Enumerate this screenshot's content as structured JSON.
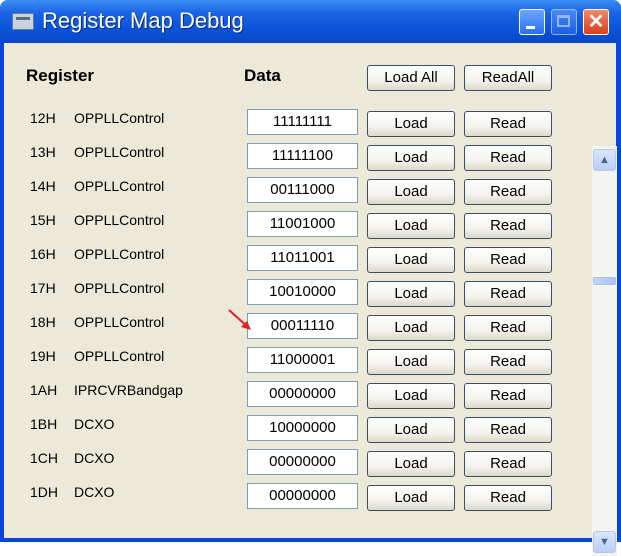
{
  "window": {
    "title": "Register Map Debug"
  },
  "header": {
    "register_label": "Register",
    "data_label": "Data",
    "load_all_label": "Load All",
    "read_all_label": "ReadAll"
  },
  "buttons": {
    "load": "Load",
    "read": "Read"
  },
  "rows": [
    {
      "addr": "12H",
      "name": "OPPLLControl",
      "value": "11111111"
    },
    {
      "addr": "13H",
      "name": "OPPLLControl",
      "value": "11111100"
    },
    {
      "addr": "14H",
      "name": "OPPLLControl",
      "value": "00111000"
    },
    {
      "addr": "15H",
      "name": "OPPLLControl",
      "value": "11001000"
    },
    {
      "addr": "16H",
      "name": "OPPLLControl",
      "value": "11011001"
    },
    {
      "addr": "17H",
      "name": "OPPLLControl",
      "value": "10010000"
    },
    {
      "addr": "18H",
      "name": "OPPLLControl",
      "value": "00011110"
    },
    {
      "addr": "19H",
      "name": "OPPLLControl",
      "value": "11000001"
    },
    {
      "addr": "1AH",
      "name": "IPRCVRBandgap",
      "value": "00000000"
    },
    {
      "addr": "1BH",
      "name": "DCXO",
      "value": "10000000"
    },
    {
      "addr": "1CH",
      "name": "DCXO",
      "value": "00000000"
    },
    {
      "addr": "1DH",
      "name": "DCXO",
      "value": "00000000"
    }
  ],
  "colors": {
    "title_bar": "#0a52d8",
    "client_bg": "#ece9d8",
    "annotation_arrow": "#e0202a"
  }
}
